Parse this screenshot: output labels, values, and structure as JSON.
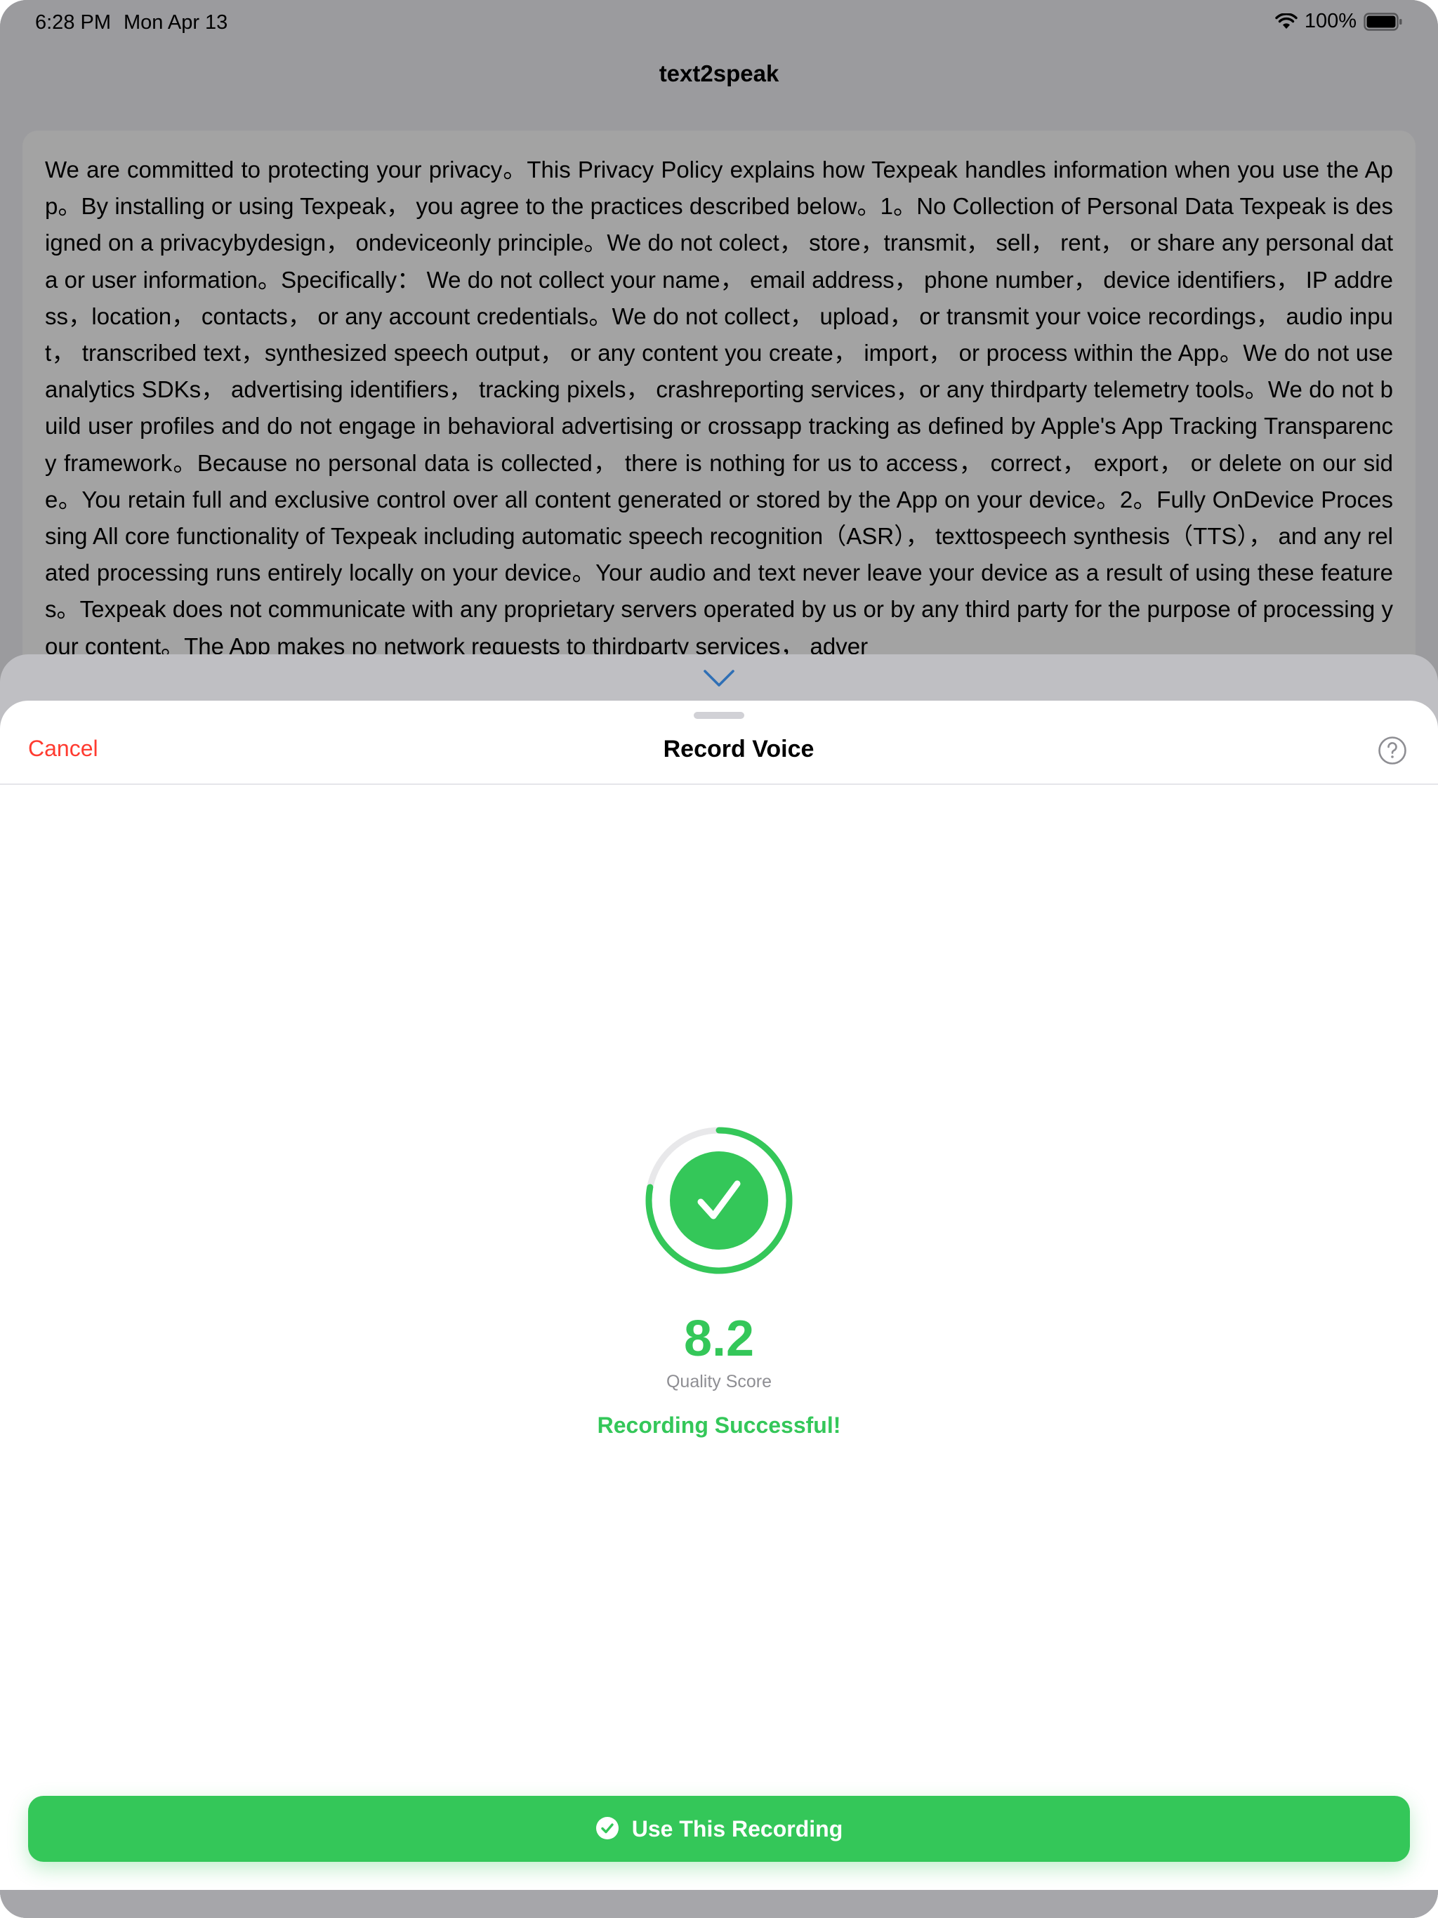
{
  "status_bar": {
    "time": "6:28 PM",
    "date": "Mon Apr 13",
    "battery": "100%"
  },
  "background_app": {
    "title": "text2speak",
    "policy_text": "We are committed to protecting your privacy。This Privacy Policy explains how Texpeak handles information when you use the App。By installing or using Texpeak， you agree to the practices described below。1。No Collection of Personal Data Texpeak is designed on a privacybydesign， ondeviceonly principle。We do not colect， store，transmit， sell， rent， or share any personal data or user information。Specifically： We do not collect your name， email address， phone number， device identifiers， IP address，location， contacts， or any account credentials。We do not collect， upload， or transmit your voice recordings， audio input， transcribed text，synthesized speech output， or any content you create， import， or process within the App。We do not use analytics SDKs， advertising identifiers， tracking pixels， crashreporting services，or any thirdparty telemetry tools。We do not build user profiles and do not engage in behavioral advertising or crossapp tracking as defined by Apple's App Tracking Transparency framework。Because no personal data is collected， there is nothing for us to access， correct， export， or delete on our side。You retain full and exclusive control over all content generated or stored by the App on your device。2。Fully OnDevice Processing All core functionality of Texpeak including automatic speech recognition（ASR）， texttospeech synthesis（TTS）， and any related processing runs entirely locally on your device。Your audio and text never leave your device as a result of using these features。Texpeak does not communicate with any proprietary servers operated by us or by any third party for the purpose of processing your content。The App makes no network requests to thirdparty services， adver"
  },
  "sheet": {
    "cancel_label": "Cancel",
    "title": "Record Voice",
    "score": "8.2",
    "score_label": "Quality Score",
    "success_message": "Recording Successful!",
    "use_button_label": "Use This Recording",
    "ring_progress": 0.78
  },
  "colors": {
    "success": "#34c759",
    "destructive": "#ff3b30",
    "accent": "#007aff"
  },
  "icons": {
    "help": "help-circle-icon",
    "check": "checkmark-icon",
    "chevron": "chevron-down-icon"
  }
}
